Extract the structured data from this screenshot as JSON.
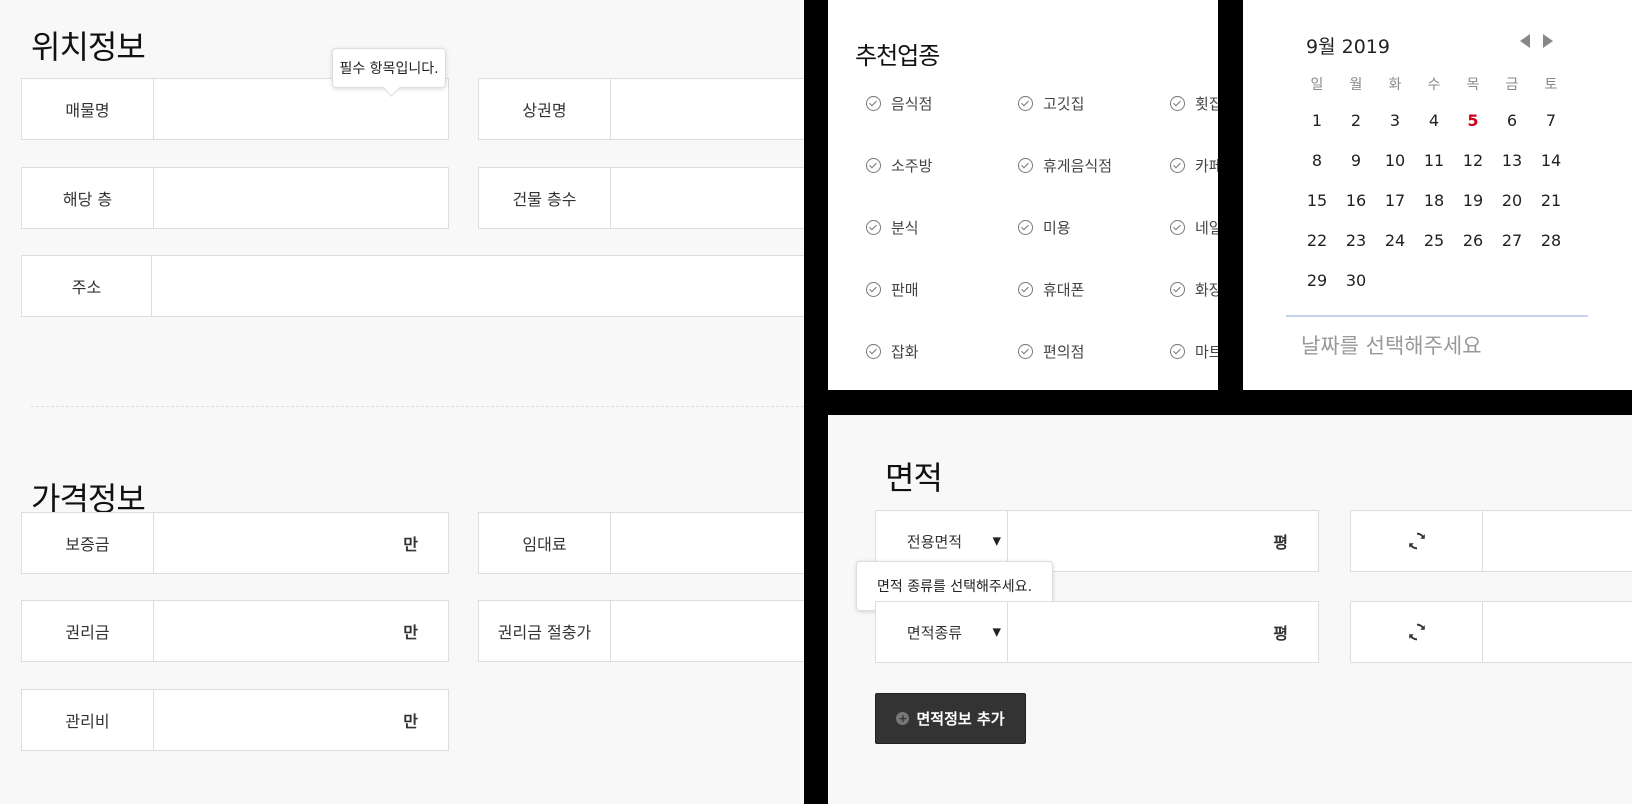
{
  "location_section": {
    "title": "위치정보",
    "fields": [
      {
        "label": "매물명",
        "value": ""
      },
      {
        "label": "상권명",
        "value": ""
      },
      {
        "label": "해당 층",
        "value": ""
      },
      {
        "label": "건물 층수",
        "value": ""
      },
      {
        "label": "주소",
        "value": ""
      }
    ],
    "required_tooltip": "필수 항목입니다."
  },
  "price_section": {
    "title": "가격정보",
    "fields": [
      {
        "label": "보증금",
        "unit": "만"
      },
      {
        "label": "임대료",
        "unit": ""
      },
      {
        "label": "권리금",
        "unit": "만"
      },
      {
        "label": "권리금 절충가",
        "unit": ""
      },
      {
        "label": "관리비",
        "unit": "만"
      }
    ]
  },
  "industry_section": {
    "title": "추천업종",
    "items": [
      "음식점",
      "고깃집",
      "횟집",
      "소주방",
      "휴게음식점",
      "카페",
      "분식",
      "미용",
      "네일",
      "판매",
      "휴대폰",
      "화장",
      "잡화",
      "편의점",
      "마트"
    ]
  },
  "calendar": {
    "month_label": "9월 2019",
    "weekdays": [
      "일",
      "월",
      "화",
      "수",
      "목",
      "금",
      "토"
    ],
    "days": [
      1,
      2,
      3,
      4,
      5,
      6,
      7,
      8,
      9,
      10,
      11,
      12,
      13,
      14,
      15,
      16,
      17,
      18,
      19,
      20,
      21,
      22,
      23,
      24,
      25,
      26,
      27,
      28,
      29,
      30
    ],
    "today": 5,
    "today_color": "#d0021b",
    "placeholder": "날짜를 선택해주세요"
  },
  "area_section": {
    "title": "면적",
    "rows": [
      {
        "select": "전용면적",
        "unit": "평"
      },
      {
        "select": "면적종류",
        "unit": "평"
      }
    ],
    "tooltip": "면적 종류를 선택해주세요.",
    "add_button": "면적정보 추가",
    "convert_icon": "refresh-icon"
  }
}
